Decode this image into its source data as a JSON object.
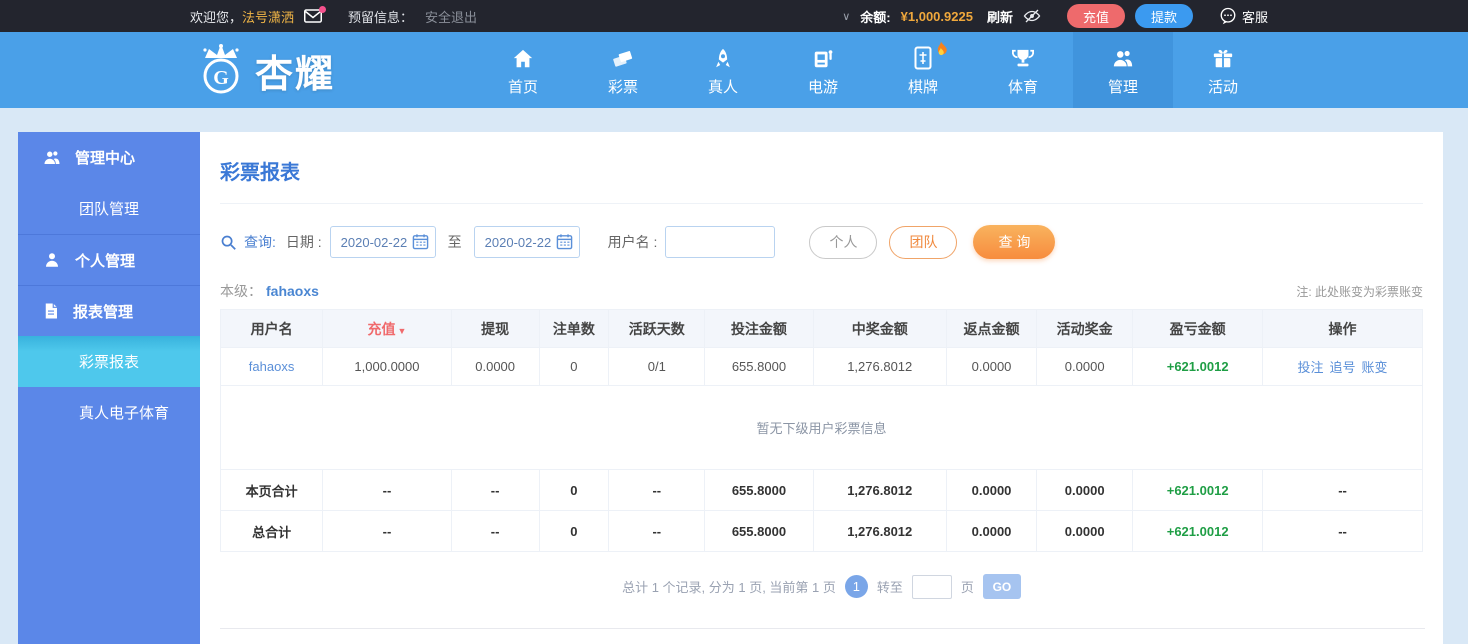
{
  "topbar": {
    "welcome": "欢迎您，",
    "username": "法号潇洒",
    "reserved_label": "预留信息：",
    "logout": "安全退出",
    "caret": "∨",
    "balance_label": "余额:",
    "balance_value": "¥1,000.9225",
    "refresh": "刷新",
    "deposit_button": "充值",
    "withdraw_button": "提款",
    "service": "客服"
  },
  "nav": {
    "brand": "杏耀",
    "items": [
      {
        "label": "首页",
        "icon": "home"
      },
      {
        "label": "彩票",
        "icon": "lottery-tickets"
      },
      {
        "label": "真人",
        "icon": "live-rocket"
      },
      {
        "label": "电游",
        "icon": "slot-machine"
      },
      {
        "label": "棋牌",
        "icon": "mahjong-tile-hot"
      },
      {
        "label": "体育",
        "icon": "trophy"
      },
      {
        "label": "管理",
        "icon": "people"
      },
      {
        "label": "活动",
        "icon": "gift"
      }
    ]
  },
  "sidebar": {
    "items": [
      {
        "label": "管理中心",
        "icon": "people"
      },
      {
        "label": "团队管理"
      },
      {
        "label": "个人管理",
        "icon": "person"
      },
      {
        "label": "报表管理",
        "icon": "document"
      },
      {
        "label": "彩票报表",
        "active": true
      },
      {
        "label": "真人电子体育"
      }
    ]
  },
  "main": {
    "title": "彩票报表",
    "search": {
      "query_label": "查询:",
      "date_label": "日期 :",
      "date_from": "2020-02-22",
      "to_label": "至",
      "date_to": "2020-02-22",
      "username_label": "用户名 :",
      "username_value": "",
      "personal_button": "个人",
      "team_button": "团队",
      "search_button": "查 询"
    },
    "level_label": "本级：",
    "level_user": "fahaoxs",
    "note": "注: 此处账变为彩票账变",
    "table": {
      "headers": [
        "用户名",
        "充值",
        "提现",
        "注单数",
        "活跃天数",
        "投注金额",
        "中奖金额",
        "返点金额",
        "活动奖金",
        "盈亏金额",
        "操作"
      ],
      "sort_indicator": "▼",
      "row": {
        "cells": [
          "fahaoxs",
          "1,000.0000",
          "0.0000",
          "0",
          "0/1",
          "655.8000",
          "1,276.8012",
          "0.0000",
          "0.0000",
          "+621.0012"
        ],
        "actions": [
          "投注",
          "追号",
          "账变"
        ]
      },
      "empty_message": "暂无下级用户彩票信息",
      "page_total": {
        "label": "本页合计",
        "cells": [
          "--",
          "--",
          "0",
          "--",
          "655.8000",
          "1,276.8012",
          "0.0000",
          "0.0000",
          "+621.0012",
          "--"
        ]
      },
      "grand_total": {
        "label": "总合计",
        "cells": [
          "--",
          "--",
          "0",
          "--",
          "655.8000",
          "1,276.8012",
          "0.0000",
          "0.0000",
          "+621.0012",
          "--"
        ]
      }
    },
    "pagination": {
      "summary": "总计 1 个记录, 分为 1 页, 当前第 1 页",
      "current_page": "1",
      "goto_label": "转至",
      "page_unit": "页",
      "go_button": "GO"
    }
  },
  "colors": {
    "topbar_bg": "#23252e",
    "nav_blue": "#4aa0e8",
    "sidebar_blue": "#5b87e8",
    "active_cyan": "#4ec8ec",
    "gold": "#f0b546",
    "orange_button": "#f78c3e",
    "sort_red": "#f06a6c",
    "profit_green": "#1f9e45",
    "link_blue": "#5a8fd8"
  }
}
